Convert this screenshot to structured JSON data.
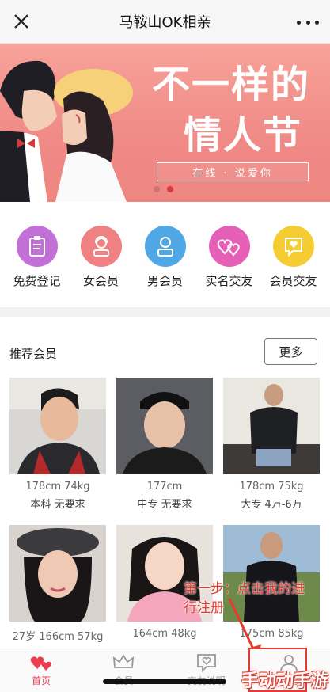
{
  "header": {
    "title": "马鞍山OK相亲"
  },
  "banner": {
    "line1": "不一样的",
    "line2": "情人节",
    "tagline": "在线 · 说爱你",
    "colors": {
      "bg": "#f08a86",
      "dot_active": "#d83b3b"
    }
  },
  "menu": [
    {
      "label": "免费登记",
      "icon": "clipboard-icon",
      "color": "#c36fd8"
    },
    {
      "label": "女会员",
      "icon": "woman-icon",
      "color": "#ef8183"
    },
    {
      "label": "男会员",
      "icon": "man-icon",
      "color": "#4fa7e6"
    },
    {
      "label": "实名交友",
      "icon": "hearts-icon",
      "color": "#e65fb6"
    },
    {
      "label": "会员交友",
      "icon": "heart-bubble-icon",
      "color": "#f5cd33"
    }
  ],
  "members": {
    "title": "推荐会员",
    "more": "更多",
    "cards": [
      {
        "l1": "178cm 74kg",
        "l2": "本科 无要求"
      },
      {
        "l1": "177cm",
        "l2": "中专 无要求"
      },
      {
        "l1": "178cm 75kg",
        "l2": "大专 4万-6万"
      },
      {
        "l1": "27岁 166cm 57kg",
        "l2": ""
      },
      {
        "l1": "164cm 48kg",
        "l2": ""
      },
      {
        "l1": "175cm 85kg",
        "l2": ""
      }
    ]
  },
  "annotation": {
    "line1": "第一步：点击我的进",
    "line2": "行注册"
  },
  "tabbar": [
    {
      "label": "首页",
      "icon": "hearts-icon",
      "active": true
    },
    {
      "label": "会员",
      "icon": "crown-icon",
      "active": false
    },
    {
      "label": "交友说明",
      "icon": "heart-chat-icon",
      "active": false
    },
    {
      "label": "我的",
      "icon": "user-icon",
      "active": false
    }
  ],
  "watermark": "手动动手游",
  "accent": "#ec3c50"
}
